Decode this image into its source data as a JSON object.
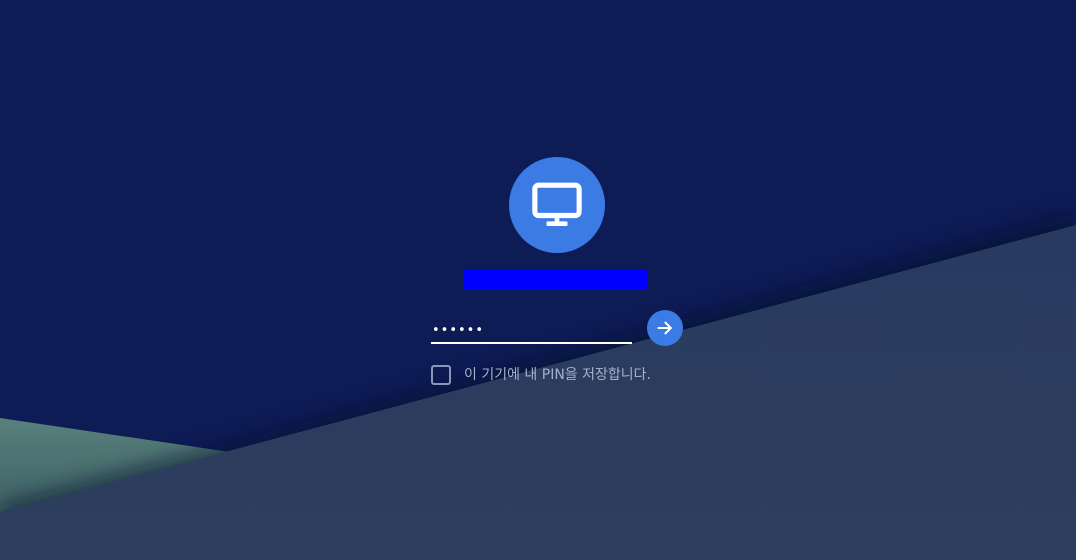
{
  "colors": {
    "background_top": "#0e1c56",
    "background_slope": "#2b3a5c",
    "background_teal": "#4d7473",
    "accent": "#3b7be4",
    "username_redaction": "#0000ff",
    "label_text": "#a7b0c8"
  },
  "avatar": {
    "icon": "monitor-icon"
  },
  "username": {
    "text": ""
  },
  "pin": {
    "value": "••••••"
  },
  "submit": {
    "icon": "arrow-right-icon"
  },
  "remember": {
    "label": "이 기기에 내 PIN을 저장합니다.",
    "checked": false
  }
}
